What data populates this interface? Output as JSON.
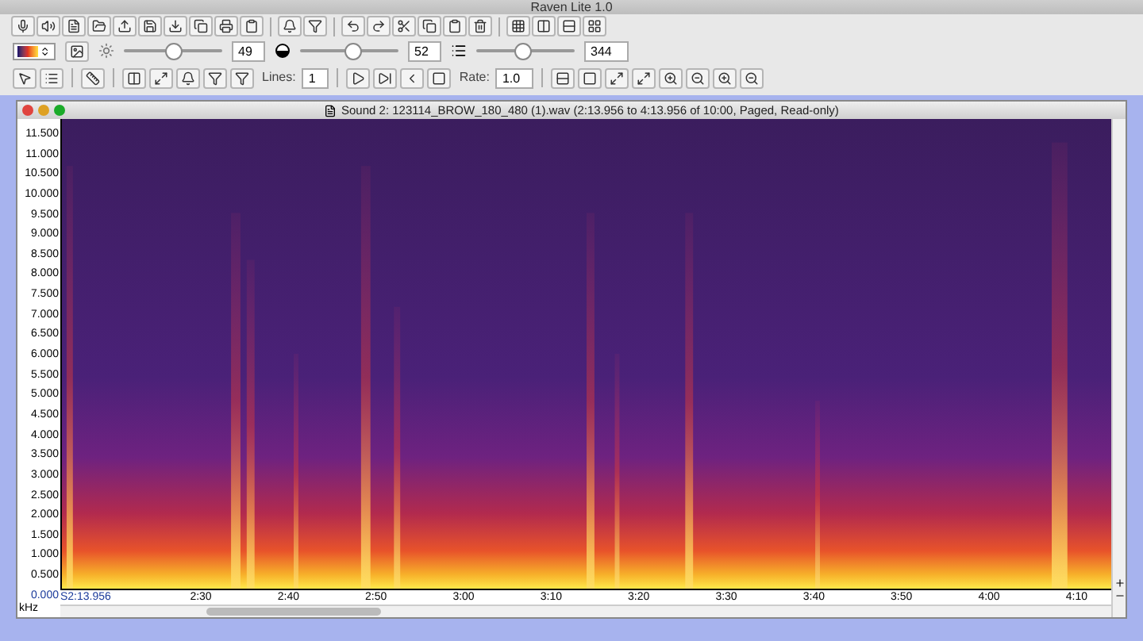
{
  "window": {
    "title": "Raven Lite 1.0"
  },
  "toolbar": {
    "brightness": {
      "level": 0.5,
      "value": "49"
    },
    "contrast": {
      "level": 0.53,
      "value": "52"
    },
    "resolution": {
      "level": 0.47,
      "value": "344"
    },
    "lines_label": "Lines:",
    "lines_value": "1",
    "rate_label": "Rate:",
    "rate_value": "1.0"
  },
  "sound_window": {
    "title": "Sound 2: 123114_BROW_180_480 (1).wav (2:13.956 to 4:13.956 of 10:00, Paged, Read-only)",
    "y_axis": {
      "unit": "kHz",
      "ticks": [
        "11.500",
        "11.000",
        "10.500",
        "10.000",
        "9.500",
        "9.000",
        "8.500",
        "8.000",
        "7.500",
        "7.000",
        "6.500",
        "6.000",
        "5.500",
        "5.000",
        "4.500",
        "4.000",
        "3.500",
        "3.000",
        "2.500",
        "2.000",
        "1.500",
        "1.000",
        "0.500",
        "0.000"
      ]
    },
    "x_axis": {
      "start": "S2:13.956",
      "ticks": [
        "2:30",
        "2:40",
        "2:50",
        "3:00",
        "3:10",
        "3:20",
        "3:30",
        "3:40",
        "3:50",
        "4:00",
        "4:10"
      ]
    }
  }
}
